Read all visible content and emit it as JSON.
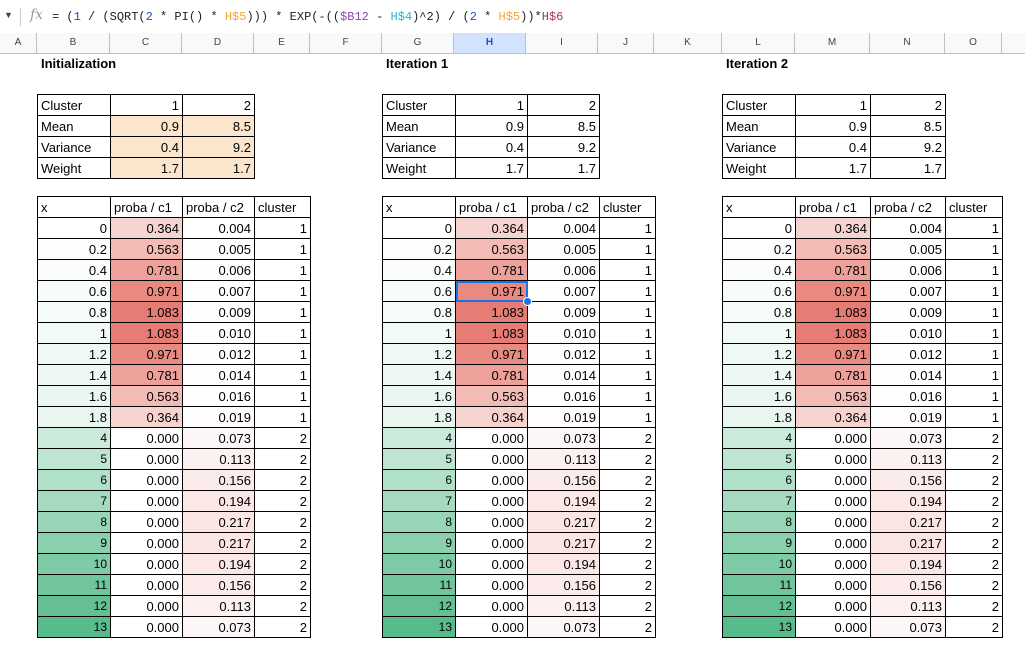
{
  "formula_bar": {
    "name_box_icon": "chevron-down-icon",
    "fx_label": "fx",
    "formula_parts": [
      {
        "t": "= (",
        "c": ""
      },
      {
        "t": "1",
        "c": "c-blue"
      },
      {
        "t": " / (SQRT(",
        "c": ""
      },
      {
        "t": "2",
        "c": "c-blue"
      },
      {
        "t": " * PI() * ",
        "c": ""
      },
      {
        "t": "H$5",
        "c": "c-orange"
      },
      {
        "t": "))) * EXP(-((",
        "c": ""
      },
      {
        "t": "$B12",
        "c": "c-purple"
      },
      {
        "t": " - ",
        "c": ""
      },
      {
        "t": "H$4",
        "c": "c-cyan"
      },
      {
        "t": ")^2) / (",
        "c": ""
      },
      {
        "t": "2",
        "c": "c-blue"
      },
      {
        "t": " * ",
        "c": ""
      },
      {
        "t": "H$5",
        "c": "c-orange"
      },
      {
        "t": "))*",
        "c": ""
      },
      {
        "t": "H$6",
        "c": "c-red"
      }
    ]
  },
  "columns": [
    "A",
    "B",
    "C",
    "D",
    "E",
    "F",
    "G",
    "H",
    "I",
    "J",
    "K",
    "L",
    "M",
    "N",
    "O"
  ],
  "selected_column": "H",
  "colors": {
    "red": "#e67c73",
    "green": "#57bb8a",
    "param_fill": "#fce5cd",
    "selection": "#1a73e8"
  },
  "sections": [
    {
      "title": "Initialization",
      "params_highlighted": true,
      "params": [
        [
          "Cluster",
          "1",
          "2"
        ],
        [
          "Mean",
          "0.9",
          "8.5"
        ],
        [
          "Variance",
          "0.4",
          "9.2"
        ],
        [
          "Weight",
          "1.7",
          "1.7"
        ]
      ],
      "headers": [
        "x",
        "proba / c1",
        "proba / c2",
        "cluster"
      ]
    },
    {
      "title": "Iteration 1",
      "params_highlighted": false,
      "params": [
        [
          "Cluster",
          "1",
          "2"
        ],
        [
          "Mean",
          "0.9",
          "8.5"
        ],
        [
          "Variance",
          "0.4",
          "9.2"
        ],
        [
          "Weight",
          "1.7",
          "1.7"
        ]
      ],
      "headers": [
        "x",
        "proba / c1",
        "proba / c2",
        "cluster"
      ]
    },
    {
      "title": "Iteration 2",
      "params_highlighted": false,
      "params": [
        [
          "Cluster",
          "1",
          "2"
        ],
        [
          "Mean",
          "0.9",
          "8.5"
        ],
        [
          "Variance",
          "0.4",
          "9.2"
        ],
        [
          "Weight",
          "1.7",
          "1.7"
        ]
      ],
      "headers": [
        "x",
        "proba / c1",
        "proba / c2",
        "cluster"
      ]
    }
  ],
  "rows": [
    [
      "0",
      "0.364",
      "0.004",
      "1"
    ],
    [
      "0.2",
      "0.563",
      "0.005",
      "1"
    ],
    [
      "0.4",
      "0.781",
      "0.006",
      "1"
    ],
    [
      "0.6",
      "0.971",
      "0.007",
      "1"
    ],
    [
      "0.8",
      "1.083",
      "0.009",
      "1"
    ],
    [
      "1",
      "1.083",
      "0.010",
      "1"
    ],
    [
      "1.2",
      "0.971",
      "0.012",
      "1"
    ],
    [
      "1.4",
      "0.781",
      "0.014",
      "1"
    ],
    [
      "1.6",
      "0.563",
      "0.016",
      "1"
    ],
    [
      "1.8",
      "0.364",
      "0.019",
      "1"
    ],
    [
      "4",
      "0.000",
      "0.073",
      "2"
    ],
    [
      "5",
      "0.000",
      "0.113",
      "2"
    ],
    [
      "6",
      "0.000",
      "0.156",
      "2"
    ],
    [
      "7",
      "0.000",
      "0.194",
      "2"
    ],
    [
      "8",
      "0.000",
      "0.217",
      "2"
    ],
    [
      "9",
      "0.000",
      "0.217",
      "2"
    ],
    [
      "10",
      "0.000",
      "0.194",
      "2"
    ],
    [
      "11",
      "0.000",
      "0.156",
      "2"
    ],
    [
      "12",
      "0.000",
      "0.113",
      "2"
    ],
    [
      "13",
      "0.000",
      "0.073",
      "2"
    ]
  ],
  "selected_cell": {
    "section": 1,
    "row": 3,
    "col": 1
  }
}
